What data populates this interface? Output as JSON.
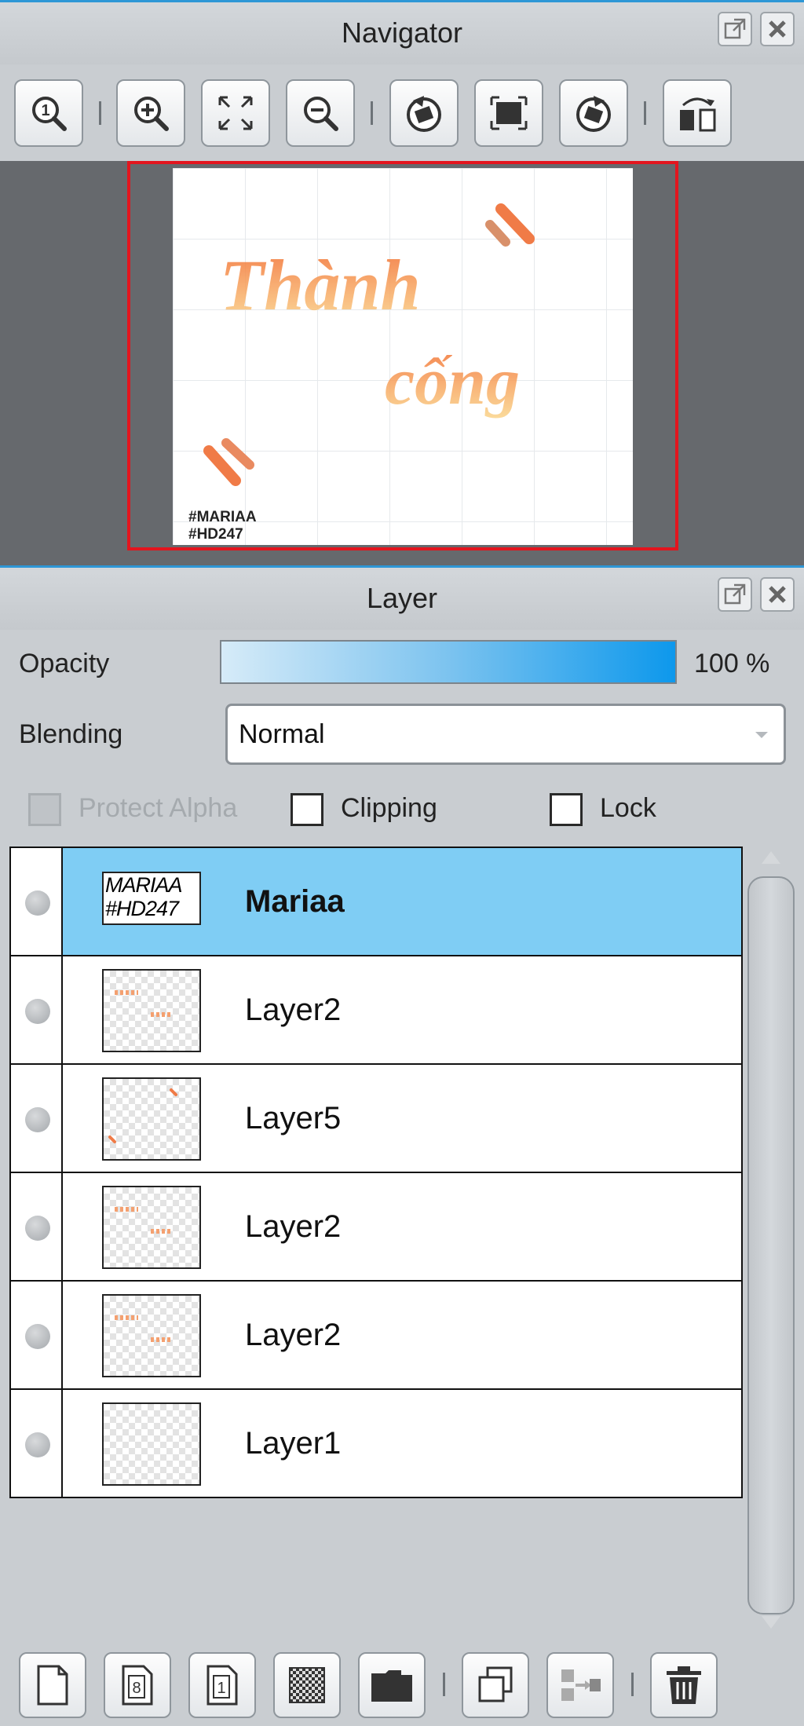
{
  "navigator": {
    "title": "Navigator",
    "tools": [
      {
        "name": "zoom-actual-icon"
      },
      {
        "name": "zoom-in-icon"
      },
      {
        "name": "fit-to-window-icon"
      },
      {
        "name": "zoom-out-icon"
      },
      {
        "name": "rotate-left-icon"
      },
      {
        "name": "reset-rotation-icon"
      },
      {
        "name": "rotate-right-icon"
      },
      {
        "name": "flip-horizontal-icon"
      }
    ],
    "preview": {
      "canvas_text_1": "Thành",
      "canvas_text_2": "cống",
      "watermark_line_1": "#MARIAA",
      "watermark_line_2": "#HD247",
      "frame_color": "#e3151e"
    }
  },
  "layer_panel": {
    "title": "Layer",
    "opacity_label": "Opacity",
    "opacity_value": "100 %",
    "opacity_fraction": 1.0,
    "blending_label": "Blending",
    "blending_value": "Normal",
    "protect_alpha_label": "Protect Alpha",
    "clipping_label": "Clipping",
    "lock_label": "Lock",
    "layers": [
      {
        "name": "Mariaa",
        "selected": true,
        "thumb_line_1": "MARIAA",
        "thumb_line_2": "#HD247"
      },
      {
        "name": "Layer2",
        "selected": false
      },
      {
        "name": "Layer5",
        "selected": false
      },
      {
        "name": "Layer2",
        "selected": false
      },
      {
        "name": "Layer2",
        "selected": false
      },
      {
        "name": "Layer1",
        "selected": false
      }
    ],
    "accent_color": "#7fcdf4",
    "bottom_tools": [
      {
        "name": "new-layer-icon"
      },
      {
        "name": "new-8bit-layer-icon"
      },
      {
        "name": "new-1bit-layer-icon"
      },
      {
        "name": "new-halftone-layer-icon"
      },
      {
        "name": "new-folder-icon"
      },
      {
        "name": "duplicate-layer-icon"
      },
      {
        "name": "merge-down-icon"
      },
      {
        "name": "delete-layer-icon"
      }
    ]
  }
}
